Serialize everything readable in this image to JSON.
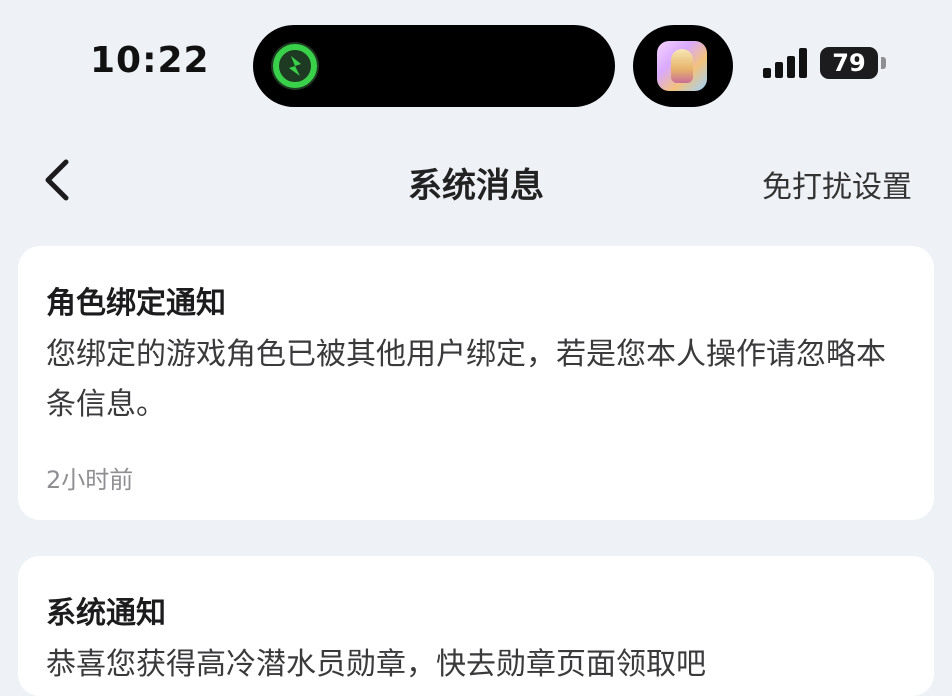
{
  "status_bar": {
    "time": "10:22",
    "battery": "79",
    "icons": {
      "activity": "activity-ring-icon",
      "app": "app-thumbnail-icon",
      "signal": "cellular-signal-icon",
      "battery": "battery-icon"
    }
  },
  "nav": {
    "title": "系统消息",
    "right_action": "免打扰设置",
    "back_icon": "chevron-left-icon"
  },
  "messages": [
    {
      "title": "角色绑定通知",
      "body": "您绑定的游戏角色已被其他用户绑定，若是您本人操作请忽略本条信息。",
      "time": "2小时前"
    },
    {
      "title": "系统通知",
      "body": "恭喜您获得高冷潜水员勋章，快去勋章页面领取吧",
      "time": ""
    }
  ],
  "colors": {
    "background": "#eef2f6",
    "card": "#ffffff",
    "accent_green": "#3ad14a"
  }
}
